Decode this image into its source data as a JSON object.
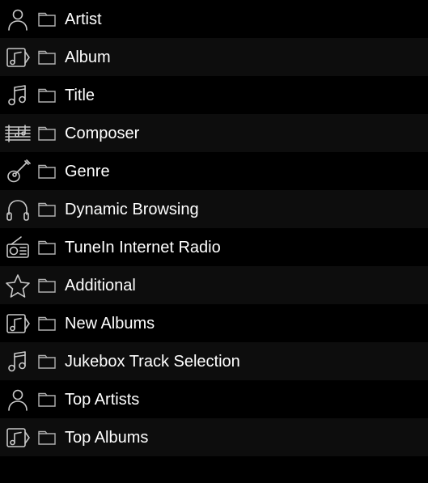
{
  "menu": {
    "items": [
      {
        "icon": "person-icon",
        "label": "Artist"
      },
      {
        "icon": "album-icon",
        "label": "Album"
      },
      {
        "icon": "note-icon",
        "label": "Title"
      },
      {
        "icon": "staff-icon",
        "label": "Composer"
      },
      {
        "icon": "guitar-icon",
        "label": "Genre"
      },
      {
        "icon": "headphones-icon",
        "label": "Dynamic Browsing"
      },
      {
        "icon": "radio-icon",
        "label": "TuneIn Internet Radio"
      },
      {
        "icon": "star-icon",
        "label": "Additional"
      },
      {
        "icon": "album-icon",
        "label": "New Albums"
      },
      {
        "icon": "note-icon",
        "label": "Jukebox Track Selection"
      },
      {
        "icon": "person-icon",
        "label": "Top Artists"
      },
      {
        "icon": "album-icon",
        "label": "Top Albums"
      }
    ]
  }
}
